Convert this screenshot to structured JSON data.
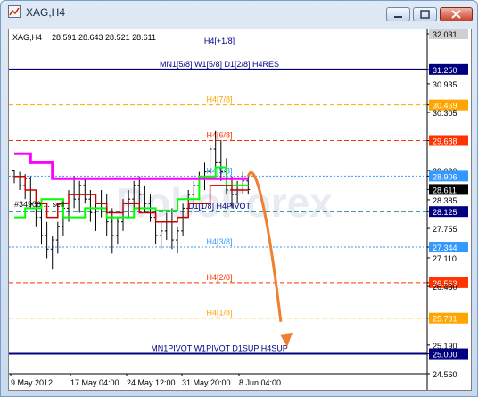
{
  "window": {
    "title": "XAG,H4",
    "buttons": {
      "minimize": "minimize",
      "maximize": "maximize",
      "close": "close"
    }
  },
  "chart_info": {
    "symbol_label": "XAG,H4",
    "ohlc": "28.591 28.643 28.521 28.611",
    "order_label": "#34906 ... sell",
    "watermark": "RoboForex"
  },
  "colors": {
    "price_bars": "#000000",
    "pink_line": "#ff00ff",
    "green_line": "#00ff00",
    "red_line": "#cc0000",
    "arrow": "#f08030",
    "navy": "#000080",
    "red_dash": "#ff3300",
    "orange_dash": "#ffa500",
    "blue_dash": "#3399ff",
    "teal_dash": "#008080"
  },
  "chart_data": {
    "type": "candlestick",
    "x_ticks": [
      "9 May 2012",
      "17 May 04:00",
      "24 May 12:00",
      "31 May 20:00",
      "8 Jun 04:00"
    ],
    "y_ticks": [
      32.031,
      31.25,
      30.935,
      30.469,
      30.305,
      29.688,
      29.03,
      28.906,
      28.611,
      28.385,
      28.125,
      27.755,
      27.344,
      27.11,
      26.563,
      26.48,
      25.781,
      25.19,
      25.0,
      24.56
    ],
    "ylim": [
      24.56,
      32.031
    ],
    "murrey_levels": [
      {
        "label": "H4[+1/8]",
        "value": 32.031,
        "style": "navy"
      },
      {
        "label": "MN1[5/8] W1[5/8] D1[2/8] H4RES",
        "value": 31.25,
        "style": "navy"
      },
      {
        "label": "H4[7/8]",
        "value": 30.469,
        "style": "orange"
      },
      {
        "label": "H4[6/8]",
        "value": 29.688,
        "style": "red"
      },
      {
        "label": "H4[5/8]",
        "value": 28.906,
        "style": "blue"
      },
      {
        "label": "D1[1/8] H4PIVOT",
        "value": 28.125,
        "style": "teal"
      },
      {
        "label": "H4[3/8]",
        "value": 27.344,
        "style": "blue"
      },
      {
        "label": "H4[2/8]",
        "value": 26.563,
        "style": "red"
      },
      {
        "label": "H4[1/8]",
        "value": 25.781,
        "style": "orange"
      },
      {
        "label": "MN1PIVOT W1PIVOT D1SUP H4SUP",
        "value": 25.0,
        "style": "navy"
      }
    ],
    "price_tags": [
      {
        "value": 32.031,
        "text": "32.031",
        "style": "tag-gray"
      },
      {
        "value": 31.25,
        "text": "31.250",
        "style": "tag-navy"
      },
      {
        "value": 30.935,
        "text": "30.935",
        "style": "plain"
      },
      {
        "value": 30.469,
        "text": "30.469",
        "style": "tag-orange"
      },
      {
        "value": 30.305,
        "text": "30.305",
        "style": "plain"
      },
      {
        "value": 29.688,
        "text": "29.688",
        "style": "tag-red"
      },
      {
        "value": 29.03,
        "text": "29.030",
        "style": "plain"
      },
      {
        "value": 28.906,
        "text": "28.906",
        "style": "tag-blue"
      },
      {
        "value": 28.611,
        "text": "28.611",
        "style": "tag-black"
      },
      {
        "value": 28.385,
        "text": "28.385",
        "style": "plain"
      },
      {
        "value": 28.125,
        "text": "28.125",
        "style": "tag-navy"
      },
      {
        "value": 27.755,
        "text": "27.755",
        "style": "plain"
      },
      {
        "value": 27.344,
        "text": "27.344",
        "style": "tag-blue"
      },
      {
        "value": 27.11,
        "text": "27.110",
        "style": "plain"
      },
      {
        "value": 26.563,
        "text": "26.563",
        "style": "tag-red"
      },
      {
        "value": 26.48,
        "text": "26.480",
        "style": "plain"
      },
      {
        "value": 25.781,
        "text": "25.781",
        "style": "tag-orange"
      },
      {
        "value": 25.19,
        "text": "25.190",
        "style": "plain"
      },
      {
        "value": 25.0,
        "text": "25.000",
        "style": "tag-navy"
      },
      {
        "value": 24.56,
        "text": "24.560",
        "style": "plain"
      }
    ],
    "bars": [
      [
        29.02,
        29.05,
        28.75,
        28.9
      ],
      [
        28.9,
        29.0,
        28.6,
        28.7
      ],
      [
        28.7,
        28.95,
        28.4,
        28.85
      ],
      [
        28.85,
        28.9,
        28.2,
        28.3
      ],
      [
        28.3,
        28.5,
        27.8,
        28.0
      ],
      [
        28.0,
        28.2,
        27.4,
        27.6
      ],
      [
        27.6,
        27.9,
        27.1,
        27.3
      ],
      [
        27.3,
        27.6,
        26.85,
        27.5
      ],
      [
        27.5,
        27.9,
        27.2,
        27.8
      ],
      [
        27.8,
        28.3,
        27.6,
        28.2
      ],
      [
        28.2,
        28.6,
        27.9,
        28.5
      ],
      [
        28.5,
        28.9,
        28.2,
        28.4
      ],
      [
        28.4,
        28.8,
        28.1,
        28.7
      ],
      [
        28.7,
        28.85,
        28.3,
        28.4
      ],
      [
        28.4,
        28.6,
        27.9,
        28.1
      ],
      [
        28.1,
        28.4,
        27.7,
        28.3
      ],
      [
        28.3,
        28.6,
        28.0,
        28.2
      ],
      [
        28.2,
        28.5,
        27.6,
        27.9
      ],
      [
        27.9,
        28.2,
        27.2,
        27.6
      ],
      [
        27.6,
        28.0,
        27.4,
        27.9
      ],
      [
        27.9,
        28.4,
        27.7,
        28.3
      ],
      [
        28.3,
        28.6,
        28.0,
        28.4
      ],
      [
        28.4,
        28.8,
        28.2,
        28.7
      ],
      [
        28.7,
        28.9,
        28.3,
        28.5
      ],
      [
        28.5,
        28.7,
        28.1,
        28.3
      ],
      [
        28.3,
        28.5,
        27.9,
        28.0
      ],
      [
        28.0,
        28.2,
        27.4,
        27.6
      ],
      [
        27.6,
        27.9,
        27.3,
        27.7
      ],
      [
        27.7,
        28.1,
        27.5,
        27.9
      ],
      [
        27.9,
        28.2,
        27.3,
        27.5
      ],
      [
        27.5,
        27.8,
        27.2,
        27.7
      ],
      [
        27.7,
        28.3,
        27.6,
        28.2
      ],
      [
        28.2,
        28.6,
        28.0,
        28.5
      ],
      [
        28.5,
        28.8,
        28.3,
        28.7
      ],
      [
        28.7,
        29.0,
        28.5,
        28.9
      ],
      [
        28.9,
        29.2,
        28.6,
        29.0
      ],
      [
        29.0,
        29.6,
        28.8,
        29.5
      ],
      [
        29.5,
        29.9,
        29.0,
        29.2
      ],
      [
        29.2,
        29.7,
        28.8,
        29.0
      ],
      [
        29.0,
        29.3,
        28.5,
        28.6
      ],
      [
        28.6,
        28.9,
        28.2,
        28.5
      ],
      [
        28.5,
        28.8,
        28.3,
        28.7
      ],
      [
        28.7,
        29.0,
        28.5,
        28.8
      ],
      [
        28.8,
        28.9,
        28.5,
        28.611
      ]
    ],
    "pink_line": [
      [
        0,
        29.4
      ],
      [
        3,
        29.4
      ],
      [
        3,
        29.2
      ],
      [
        7,
        29.2
      ],
      [
        7,
        28.85
      ],
      [
        43,
        28.85
      ]
    ],
    "red_line": [
      [
        0,
        28.9
      ],
      [
        2,
        28.9
      ],
      [
        2,
        28.6
      ],
      [
        4,
        28.6
      ],
      [
        4,
        28.3
      ],
      [
        6,
        28.3
      ],
      [
        6,
        28.0
      ],
      [
        8,
        28.0
      ],
      [
        8,
        28.3
      ],
      [
        10,
        28.3
      ],
      [
        10,
        28.5
      ],
      [
        15,
        28.5
      ],
      [
        15,
        28.3
      ],
      [
        17,
        28.3
      ],
      [
        17,
        28.1
      ],
      [
        20,
        28.1
      ],
      [
        20,
        28.3
      ],
      [
        23,
        28.3
      ],
      [
        23,
        28.1
      ],
      [
        26,
        28.1
      ],
      [
        26,
        27.9
      ],
      [
        30,
        27.9
      ],
      [
        30,
        28.0
      ],
      [
        32,
        28.0
      ],
      [
        32,
        28.3
      ],
      [
        36,
        28.3
      ],
      [
        36,
        28.7
      ],
      [
        40,
        28.7
      ],
      [
        40,
        28.6
      ],
      [
        43,
        28.6
      ]
    ],
    "green_line": [
      [
        0,
        28.0
      ],
      [
        2,
        28.0
      ],
      [
        2,
        28.2
      ],
      [
        5,
        28.2
      ],
      [
        5,
        28.4
      ],
      [
        9,
        28.4
      ],
      [
        9,
        28.0
      ],
      [
        13,
        28.0
      ],
      [
        13,
        28.2
      ],
      [
        17,
        28.2
      ],
      [
        17,
        28.0
      ],
      [
        22,
        28.0
      ],
      [
        22,
        28.2
      ],
      [
        26,
        28.2
      ],
      [
        26,
        28.15
      ],
      [
        30,
        28.15
      ],
      [
        30,
        28.4
      ],
      [
        34,
        28.4
      ],
      [
        34,
        28.9
      ],
      [
        37,
        28.9
      ],
      [
        37,
        29.1
      ],
      [
        39,
        29.1
      ],
      [
        39,
        28.7
      ],
      [
        43,
        28.7
      ]
    ],
    "forecast_arrow": [
      [
        43,
        28.9
      ],
      [
        44,
        29.05
      ],
      [
        46,
        28.4
      ],
      [
        49,
        25.7
      ],
      [
        50,
        25.15
      ]
    ]
  }
}
